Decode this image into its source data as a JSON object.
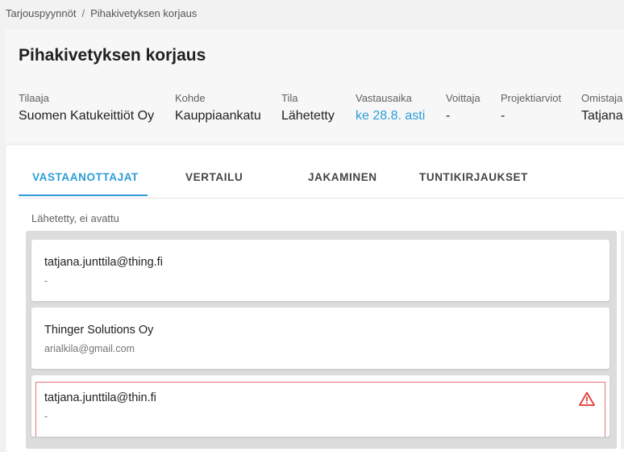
{
  "breadcrumb": {
    "parent": "Tarjouspyynnöt",
    "separator": "/",
    "current": "Pihakivetyksen korjaus"
  },
  "header": {
    "title": "Pihakivetyksen korjaus",
    "meta": [
      {
        "label": "Tilaaja",
        "value": "Suomen Katukeittiöt Oy"
      },
      {
        "label": "Kohde",
        "value": "Kauppiaankatu"
      },
      {
        "label": "Tila",
        "value": "Lähetetty"
      },
      {
        "label": "Vastausaika",
        "value": "ke 28.8. asti"
      },
      {
        "label": "Voittaja",
        "value": "-"
      },
      {
        "label": "Projektiarviot",
        "value": "-"
      },
      {
        "label": "Omistaja",
        "value": "Tatjana"
      }
    ]
  },
  "tabs": [
    {
      "label": "VASTAANOTTAJAT",
      "active": true
    },
    {
      "label": "VERTAILU",
      "active": false
    },
    {
      "label": "JAKAMINEN",
      "active": false
    },
    {
      "label": "TUNTIKIRJAUKSET",
      "active": false
    }
  ],
  "section": {
    "label": "Lähetetty, ei avattu"
  },
  "recipients": [
    {
      "name": "tatjana.junttila@thing.fi",
      "sub": "-",
      "error": false
    },
    {
      "name": "Thinger Solutions Oy",
      "sub": "arialkila@gmail.com",
      "error": false
    },
    {
      "name": "tatjana.junttila@thin.fi",
      "sub": "-",
      "error": true,
      "icon": "warning-icon"
    }
  ],
  "colors": {
    "accent": "#2b9cd8",
    "error": "#e53935"
  }
}
